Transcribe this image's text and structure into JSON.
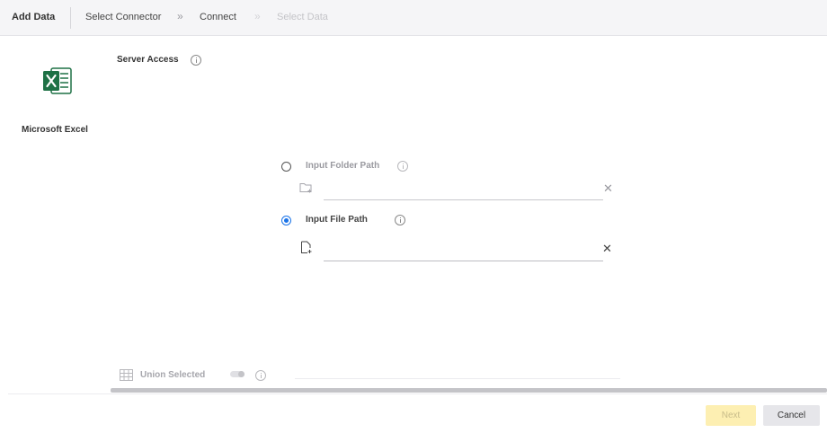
{
  "header": {
    "title": "Add Data",
    "steps": [
      {
        "label": "Select Connector"
      },
      {
        "label": "Connect"
      },
      {
        "label": "Select Data"
      }
    ]
  },
  "connector": {
    "icon": "excel-icon",
    "name": "Microsoft Excel"
  },
  "server_access": {
    "label": "Server Access",
    "options": [
      {
        "label": "Input Folder Path",
        "selected": false,
        "icon": "folder-add-icon",
        "value": ""
      },
      {
        "label": "Input File Path",
        "selected": true,
        "icon": "file-add-icon",
        "value": ""
      }
    ]
  },
  "union": {
    "icon": "grid-icon",
    "label": "Union Selected",
    "enabled": false
  },
  "footer": {
    "next_label": "Next",
    "cancel_label": "Cancel"
  },
  "colors": {
    "accent": "#1a73e8",
    "excel_green": "#1e7145",
    "next_disabled_bg": "#fdefb2"
  }
}
